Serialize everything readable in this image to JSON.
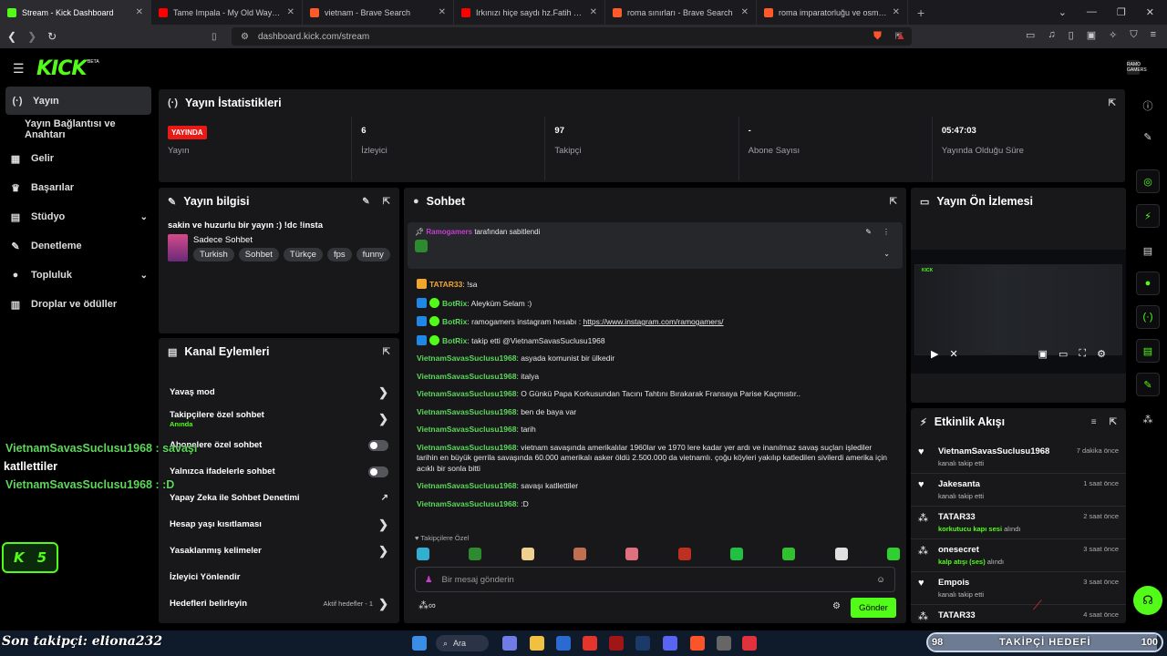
{
  "tabs": [
    {
      "title": "Stream - Kick Dashboard",
      "color": "#53fc18",
      "active": true
    },
    {
      "title": "Tame Impala - My Old Ways (Official",
      "color": "#ff0000"
    },
    {
      "title": "vietnam - Brave Search",
      "color": "#ff5a2a"
    },
    {
      "title": "Irkınızı hiçe saydı hz.Fatih biraz daha",
      "color": "#ff0000"
    },
    {
      "title": "roma sınırları - Brave Search",
      "color": "#ff5a2a"
    },
    {
      "title": "roma imparatorluğu ve osmanlı impa",
      "color": "#ff5a2a"
    }
  ],
  "address": {
    "url": "dashboard.kick.com/stream"
  },
  "header": {
    "logo": "KICK",
    "beta": "BETA",
    "avatar": "RAMO GAMERS"
  },
  "sidebar": [
    {
      "label": "Yayın",
      "icon": "(·)",
      "active": true
    },
    {
      "label": "Yayın Bağlantısı ve Anahtarı",
      "sub": true
    },
    {
      "label": "Gelir",
      "icon": "▦"
    },
    {
      "label": "Başarılar",
      "icon": "♛"
    },
    {
      "label": "Stüdyo",
      "icon": "▤",
      "chev": "⌄"
    },
    {
      "label": "Denetleme",
      "icon": "✎"
    },
    {
      "label": "Topluluk",
      "icon": "●",
      "chev": "⌄"
    },
    {
      "label": "Droplar ve ödüller",
      "icon": "▥"
    }
  ],
  "stats": {
    "title": "Yayın İstatistikleri",
    "items": [
      {
        "value": "YAYINDA",
        "label": "Yayın"
      },
      {
        "value": "6",
        "label": "İzleyici"
      },
      {
        "value": "97",
        "label": "Takipçi"
      },
      {
        "value": "-",
        "label": "Abone Sayısı"
      },
      {
        "value": "05:47:03",
        "label": "Yayında Olduğu Süre"
      }
    ]
  },
  "info": {
    "title": "Yayın bilgisi",
    "stream_title": "sakin ve huzurlu bir yayın :) !dc !insta",
    "category": "Sadece Sohbet",
    "tags": [
      "Turkish",
      "Sohbet",
      "Türkçe",
      "fps",
      "funny"
    ]
  },
  "actions": {
    "title": "Kanal Eylemleri",
    "items": [
      {
        "label": "Yavaş mod",
        "type": "chev"
      },
      {
        "label": "Takipçilere özel sohbet",
        "sub": "Anında",
        "type": "chev"
      },
      {
        "label": "Abonelere özel sohbet",
        "type": "toggle"
      },
      {
        "label": "Yalnızca ifadelerle sohbet",
        "type": "toggle"
      },
      {
        "label": "Yapay Zeka ile Sohbet Denetimi",
        "type": "ext"
      },
      {
        "label": "Hesap yaşı kısıtlaması",
        "type": "chev"
      },
      {
        "label": "Yasaklanmış kelimeler",
        "type": "chev"
      },
      {
        "label": "İzleyici Yönlendir",
        "type": "none"
      },
      {
        "label": "Hedefleri belirleyin",
        "type": "chev",
        "extra": "Aktif hedefler - 1"
      }
    ]
  },
  "chat": {
    "title": "Sohbet",
    "pinned_user": "Ramogamers",
    "pinned_text": "tarafından sabitlendi",
    "messages": [
      {
        "user": "TATAR33",
        "text": "!sa",
        "badge": "y",
        "cls": "y"
      },
      {
        "user": "BotRix",
        "text": "Aleyküm Selam :)",
        "badge": "b",
        "cls": "g"
      },
      {
        "user": "BotRix",
        "text": "ramogamers instagram hesabı : ",
        "link": "https://www.instagram.com/ramogamers/",
        "badge": "b",
        "cls": "g"
      },
      {
        "user": "BotRix",
        "text": "takip etti @VietnamSavasSuclusu1968",
        "badge": "b",
        "cls": "g"
      },
      {
        "user": "VietnamSavasSuclusu1968",
        "text": "asyada komunist bir ülkedir",
        "cls": "g"
      },
      {
        "user": "VietnamSavasSuclusu1968",
        "text": "italya",
        "cls": "g"
      },
      {
        "user": "VietnamSavasSuclusu1968",
        "text": "O Günkü Papa Korkusundan Tacını Tahtını Bırakarak Fransaya Parise Kaçmıstır..",
        "cls": "g"
      },
      {
        "user": "VietnamSavasSuclusu1968",
        "text": "ben de baya var",
        "cls": "g"
      },
      {
        "user": "VietnamSavasSuclusu1968",
        "text": "tarih",
        "cls": "g"
      },
      {
        "user": "VietnamSavasSuclusu1968",
        "text": "vietnam savaşında amerikalılar 1960lar ve 1970 lere kadar yer ardı ve inanılmaz savaş suçları işlediler tarihin en büyük gerrila savaşında 60.000 amerikalı asker öldü 2.500.000 da vietnamlı. çoğu köyleri yakılıp katledilen sivilerdi amerika için acıklı bir sonla bitti",
        "cls": "g"
      },
      {
        "user": "VietnamSavasSuclusu1968",
        "text": "savaşı katllettiler",
        "cls": "g"
      },
      {
        "user": "VietnamSavasSuclusu1968",
        "text": ":D",
        "cls": "g"
      }
    ],
    "followers_only": "Takipçilere Özel",
    "input_placeholder": "Bir mesaj gönderin",
    "send": "Gönder"
  },
  "preview": {
    "title": "Yayın Ön İzlemesi"
  },
  "feed": {
    "title": "Etkinlik Akışı",
    "events": [
      {
        "name": "VietnamSavasSuclusu1968",
        "desc": "kanalı takip etti",
        "time": "7 dakika önce",
        "icon": "♥"
      },
      {
        "name": "Jakesanta",
        "desc": "kanalı takip etti",
        "time": "1 saat önce",
        "icon": "♥"
      },
      {
        "name": "TATAR33",
        "reward": "korkutucu kapı sesi",
        "desc": "alındı",
        "time": "2 saat önce",
        "icon": "⁂"
      },
      {
        "name": "onesecret",
        "reward": "kalp atışı (ses)",
        "desc": "alındı",
        "time": "3 saat önce",
        "icon": "⁂"
      },
      {
        "name": "Empois",
        "desc": "kanalı takip etti",
        "time": "3 saat önce",
        "icon": "♥"
      },
      {
        "name": "TATAR33",
        "desc": "",
        "time": "4 saat önce",
        "icon": "⁂"
      }
    ]
  },
  "overlay": {
    "line1": "VietnamSavasSuclusu1968 : savaşı",
    "line2": "katllettiler",
    "line3": "VietnamSavasSuclusu1968 : :D",
    "k": "K",
    "k_num": "5",
    "last_follower": "Son takipçi: eliona232",
    "goal_current": "98",
    "goal_label": "TAKİPÇİ HEDEFİ",
    "goal_target": "100",
    "goal_progress": 0.98
  },
  "taskbar": {
    "search": "Ara"
  }
}
